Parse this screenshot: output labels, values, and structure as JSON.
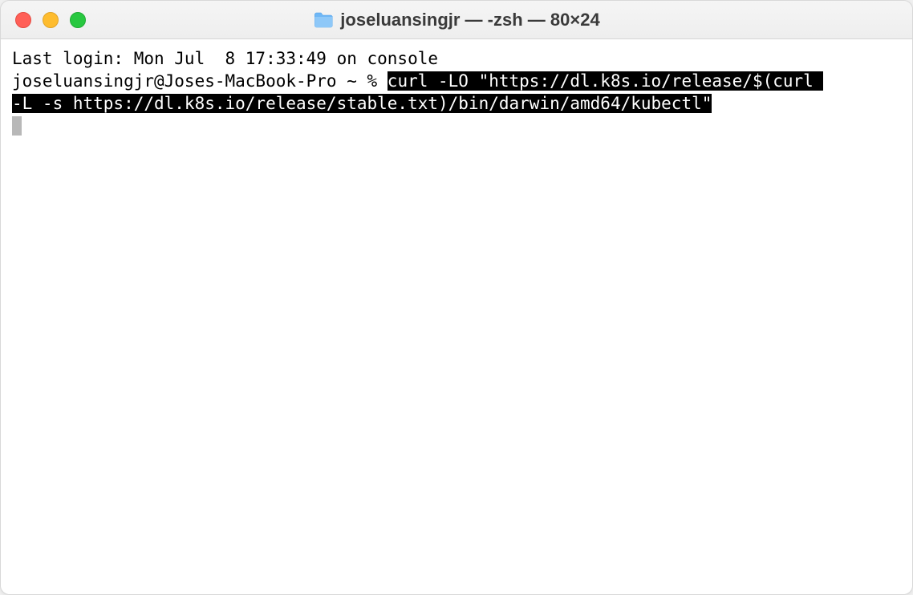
{
  "window": {
    "title": "joseluansingjr — -zsh — 80×24",
    "traffic_lights": {
      "close": "close",
      "minimize": "minimize",
      "maximize": "maximize"
    },
    "folder_icon": "folder-icon"
  },
  "terminal": {
    "last_login": "Last login: Mon Jul  8 17:33:49 on console",
    "prompt": "joseluansingjr@Joses-MacBook-Pro ~ % ",
    "command_line1": "curl -LO \"https://dl.k8s.io/release/$(curl ",
    "command_line2": "-L -s https://dl.k8s.io/release/stable.txt)/bin/darwin/amd64/kubectl\""
  }
}
